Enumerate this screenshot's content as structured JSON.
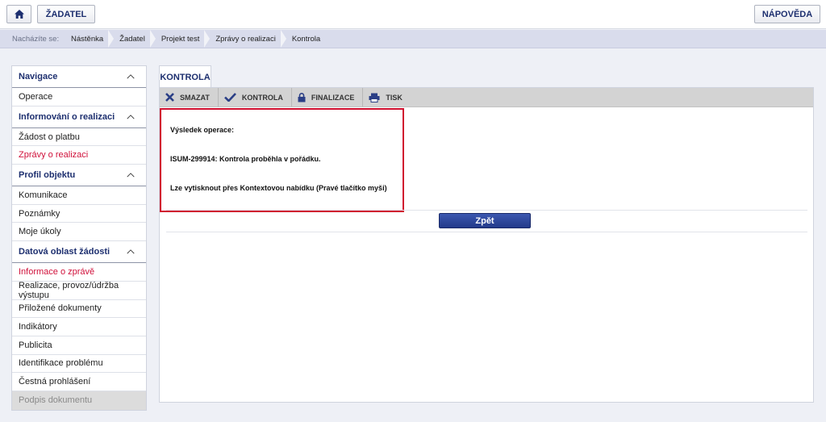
{
  "topbar": {
    "home_icon": "home-icon",
    "zadatel_label": "ŽADATEL",
    "napoveda_label": "NÁPOVĚDA"
  },
  "breadcrumb": {
    "label": "Nacházíte se:",
    "items": [
      "Nástěnka",
      "Žadatel",
      "Projekt test",
      "Zprávy o realizaci",
      "Kontrola"
    ]
  },
  "sidebar": {
    "sections": [
      {
        "title": "Navigace",
        "items": [
          {
            "label": "Operace"
          }
        ]
      },
      {
        "title": "Informování o realizaci",
        "items": [
          {
            "label": "Žádost o platbu"
          },
          {
            "label": "Zprávy o realizaci",
            "state": "active"
          }
        ]
      },
      {
        "title": "Profil objektu",
        "items": [
          {
            "label": "Komunikace"
          },
          {
            "label": "Poznámky"
          },
          {
            "label": "Moje úkoly"
          }
        ]
      },
      {
        "title": "Datová oblast žádosti",
        "items": [
          {
            "label": "Informace o zprávě",
            "state": "active"
          },
          {
            "label": "Realizace, provoz/údržba výstupu"
          },
          {
            "label": "Přiložené dokumenty"
          },
          {
            "label": "Indikátory"
          },
          {
            "label": "Publicita"
          },
          {
            "label": "Identifikace problému"
          },
          {
            "label": "Čestná prohlášení"
          },
          {
            "label": "Podpis dokumentu",
            "state": "disabled"
          }
        ]
      }
    ]
  },
  "main": {
    "tab_label": "KONTROLA",
    "toolbar": {
      "smazat": "SMAZAT",
      "kontrola": "KONTROLA",
      "finalizace": "FINALIZACE",
      "tisk": "TISK"
    },
    "result": {
      "line1": "Výsledek operace:",
      "line2": "ISUM-299914: Kontrola proběhla v pořádku.",
      "line3": "Lze vytisknout přes Kontextovou nabídku (Pravé tlačítko myši)"
    },
    "back_button": "Zpět"
  },
  "colors": {
    "brand": "#1d2f6f",
    "active_link": "#d0103a",
    "highlight_border": "#d0102f",
    "primary_button": "#2a4294"
  }
}
